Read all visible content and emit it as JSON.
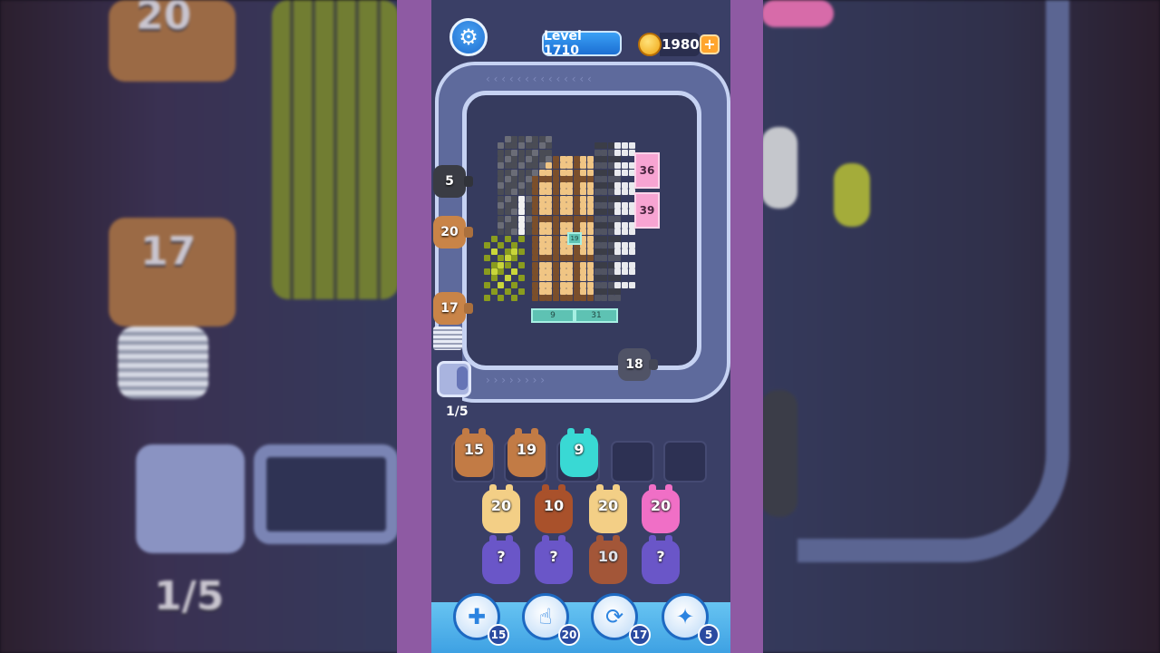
{
  "header": {
    "level_label": "Level 1710",
    "coins": "1980",
    "plus_label": "+",
    "gear_glyph": "⚙"
  },
  "board": {
    "pink_blocks": [
      "36",
      "39"
    ],
    "teal_blocks": [
      "9",
      "31"
    ],
    "center_tag": "19"
  },
  "belt_shooters": [
    {
      "count": "5",
      "color": "#3a3c44"
    },
    {
      "count": "20",
      "color": "#c98448"
    },
    {
      "count": "17",
      "color": "#c98448"
    },
    {
      "count": "18",
      "color": "#505366"
    }
  ],
  "queue_counter": "1/5",
  "slots": [
    {
      "count": "15",
      "color": "#c27b45"
    },
    {
      "count": "19",
      "color": "#c27b45"
    },
    {
      "count": "9",
      "color": "#39d9d4"
    },
    {
      "count": "",
      "color": ""
    },
    {
      "count": "",
      "color": ""
    }
  ],
  "pig_rows": [
    [
      {
        "count": "20",
        "color": "#f3cf86"
      },
      {
        "count": "10",
        "color": "#a9512b"
      },
      {
        "count": "20",
        "color": "#f3cf86"
      },
      {
        "count": "20",
        "color": "#f06fc6"
      }
    ],
    [
      {
        "count": "?",
        "color": "#6a56c8"
      },
      {
        "count": "?",
        "color": "#6a56c8"
      },
      {
        "count": "10",
        "color": "#b65b30"
      },
      {
        "count": "?",
        "color": "#6a56c8"
      }
    ]
  ],
  "tools": [
    {
      "name": "add-slot",
      "glyph": "✚",
      "count": "15"
    },
    {
      "name": "hand",
      "glyph": "☝",
      "count": "20"
    },
    {
      "name": "shuffle",
      "glyph": "⟳",
      "count": "17"
    },
    {
      "name": "magnet",
      "glyph": "✦",
      "count": "5"
    }
  ],
  "background": {
    "left_numbers": [
      "20",
      "17",
      "1/5"
    ]
  }
}
